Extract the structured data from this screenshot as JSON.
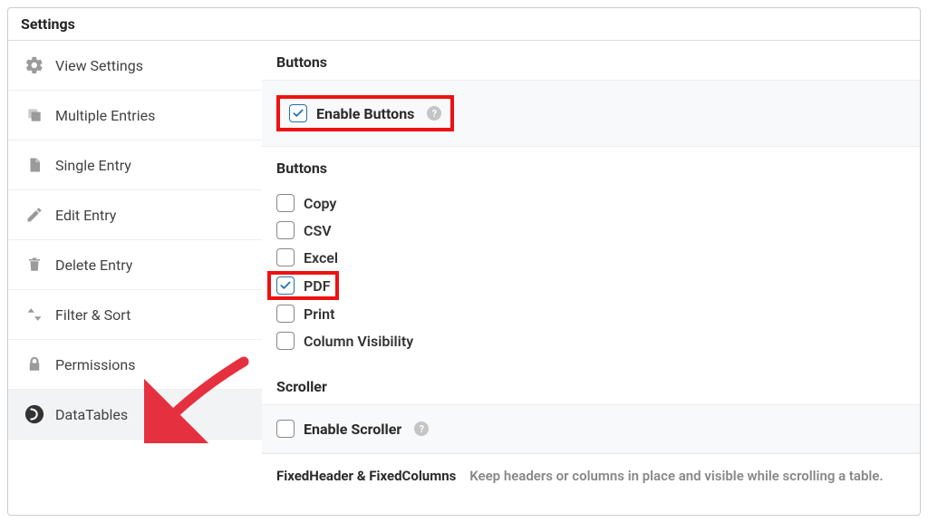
{
  "panel": {
    "title": "Settings"
  },
  "sidebar": {
    "items": [
      {
        "label": "View Settings"
      },
      {
        "label": "Multiple Entries"
      },
      {
        "label": "Single Entry"
      },
      {
        "label": "Edit Entry"
      },
      {
        "label": "Delete Entry"
      },
      {
        "label": "Filter & Sort"
      },
      {
        "label": "Permissions"
      },
      {
        "label": "DataTables"
      }
    ]
  },
  "sections": {
    "buttons_heading": "Buttons",
    "enable_buttons_label": "Enable Buttons",
    "buttons_list_heading": "Buttons",
    "scroller_heading": "Scroller",
    "enable_scroller_label": "Enable Scroller",
    "fixed_title": "FixedHeader & FixedColumns",
    "fixed_desc": "Keep headers or columns in place and visible while scrolling a table."
  },
  "buttons": {
    "copy": "Copy",
    "csv": "CSV",
    "excel": "Excel",
    "pdf": "PDF",
    "print": "Print",
    "colvis": "Column Visibility"
  }
}
